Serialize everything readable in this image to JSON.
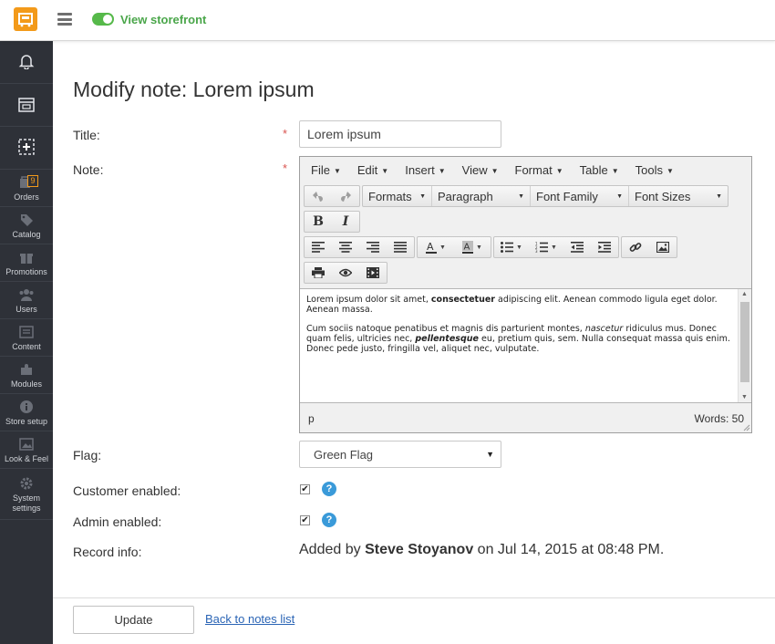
{
  "topbar": {
    "storefront_label": "View storefront",
    "toggle_on": true,
    "accent": "#56b94a",
    "logo_color": "#f39a1a"
  },
  "sidebar": {
    "items": [
      {
        "icon": "bell-icon",
        "label": ""
      },
      {
        "icon": "store-icon",
        "label": ""
      },
      {
        "icon": "add-icon",
        "label": ""
      },
      {
        "icon": "orders-icon",
        "label": "Orders",
        "badge": "9"
      },
      {
        "icon": "catalog-icon",
        "label": "Catalog"
      },
      {
        "icon": "gift-icon",
        "label": "Promotions"
      },
      {
        "icon": "users-icon",
        "label": "Users"
      },
      {
        "icon": "content-icon",
        "label": "Content"
      },
      {
        "icon": "puzzle-icon",
        "label": "Modules"
      },
      {
        "icon": "info-icon",
        "label": "Store setup"
      },
      {
        "icon": "image-icon",
        "label": "Look & Feel"
      },
      {
        "icon": "gear-icon",
        "label": "System settings"
      }
    ]
  },
  "page": {
    "title": "Modify note: Lorem ipsum"
  },
  "form": {
    "title_label": "Title:",
    "title_value": "Lorem ipsum",
    "required_mark": "*",
    "note_label": "Note:",
    "flag_label": "Flag:",
    "flag_value": "Green Flag",
    "customer_enabled_label": "Customer enabled:",
    "customer_enabled_checked": true,
    "admin_enabled_label": "Admin enabled:",
    "admin_enabled_checked": true,
    "help_glyph": "?",
    "record_info_label": "Record info:",
    "record_prefix": "Added by",
    "record_user": "Steve Stoyanov",
    "record_suffix": "on Jul 14, 2015 at 08:48 PM."
  },
  "editor": {
    "menus": [
      "File",
      "Edit",
      "Insert",
      "View",
      "Format",
      "Table",
      "Tools"
    ],
    "dropdowns": [
      "Formats",
      "Paragraph",
      "Font Family",
      "Font Sizes"
    ],
    "content": {
      "p1_a": "Lorem ipsum dolor sit amet, ",
      "p1_b": "consectetuer",
      "p1_c": " adipiscing elit. Aenean commodo ligula eget dolor. Aenean massa.",
      "p2_a": "Cum sociis natoque penatibus et magnis dis parturient montes, ",
      "p2_b": "nascetur",
      "p2_c": " ridiculus mus. Donec quam felis, ultricies nec, ",
      "p2_d": "pellentesque",
      "p2_e": " eu, pretium quis, sem. Nulla consequat massa quis enim. Donec pede justo, fringilla vel, aliquet nec, vulputate."
    },
    "status_path": "p",
    "word_count": "Words: 50"
  },
  "footer": {
    "update_label": "Update",
    "back_label": "Back to notes list"
  }
}
